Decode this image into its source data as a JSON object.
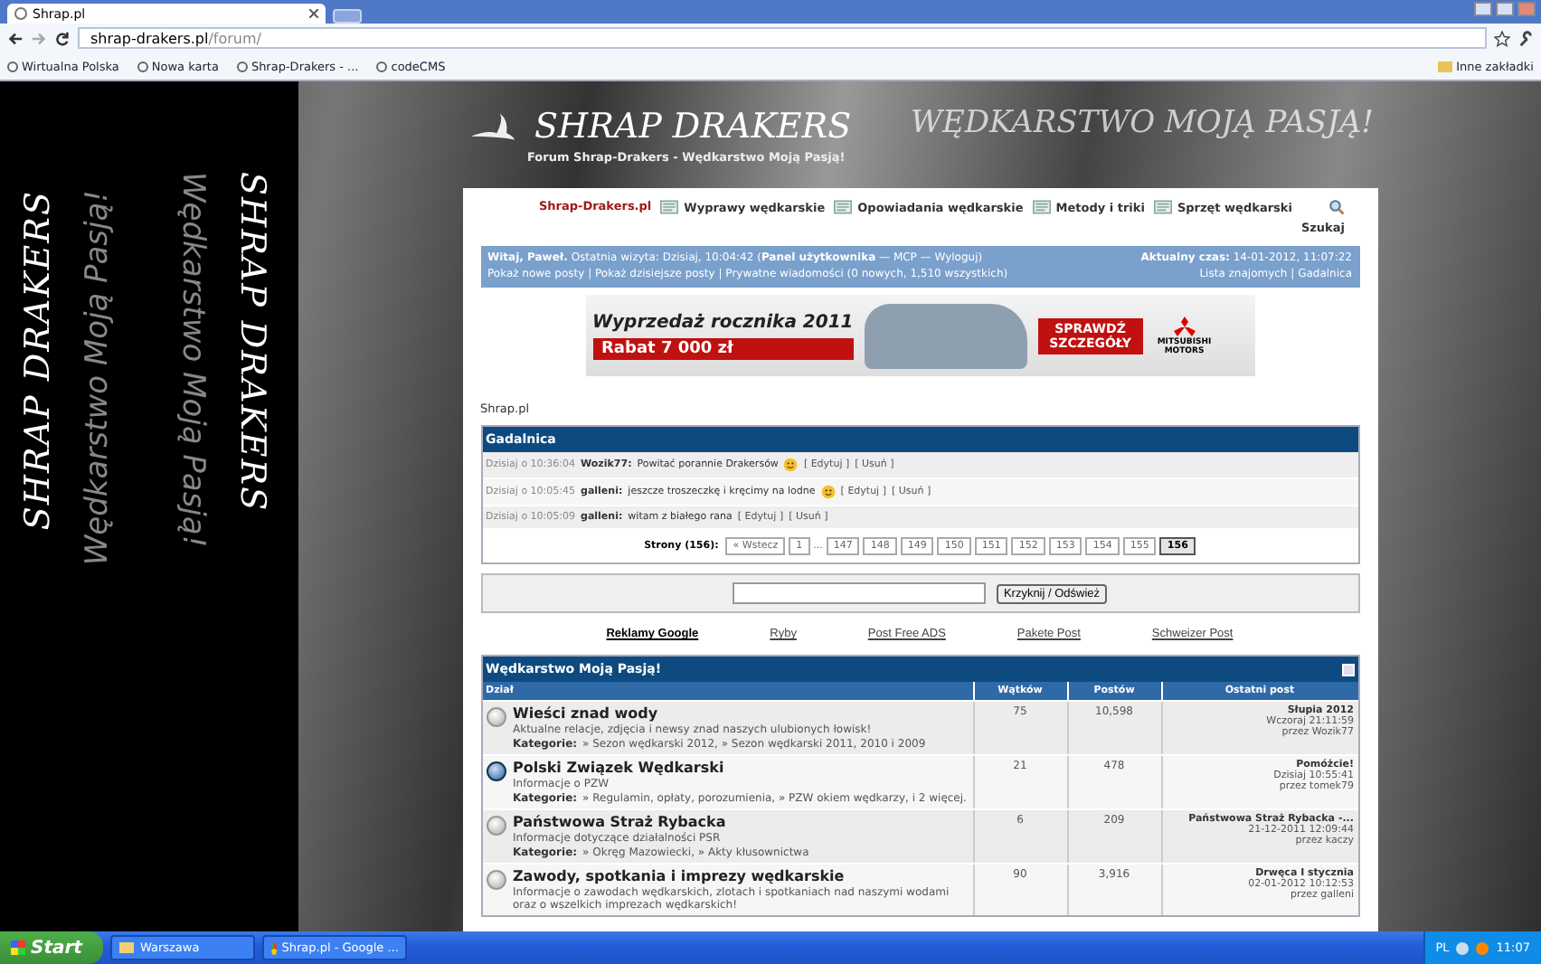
{
  "browser": {
    "tab_title": "Shrap.pl",
    "address_host": "shrap-drakers.pl",
    "address_path": "/forum/",
    "bookmarks": [
      "Wirtualna Polska",
      "Nowa karta",
      "Shrap-Drakers - ...",
      "codeCMS"
    ],
    "other_bookmarks": "Inne zakładki"
  },
  "side_banners": [
    {
      "title": "SHRAP DRAKERS",
      "slogan": "Wędkarstwo Moją Pasją!"
    },
    {
      "title": "SHRAP DRAKERS",
      "slogan": "Wędkarstwo Moją Pasją!"
    }
  ],
  "header": {
    "logo": "SHRAP DRAKERS",
    "subtitle": "Forum Shrap-Drakers - Wędkarstwo Moją Pasją!",
    "slogan": "WĘDKARSTWO MOJĄ PASJĄ!"
  },
  "nav": [
    {
      "kind": "home",
      "label": "Shrap-Drakers.pl"
    },
    {
      "kind": "link",
      "label": "Wyprawy wędkarskie"
    },
    {
      "kind": "link",
      "label": "Opowiadania wędkarskie"
    },
    {
      "kind": "link",
      "label": "Metody i triki"
    },
    {
      "kind": "link",
      "label": "Sprzęt wędkarski"
    },
    {
      "kind": "search",
      "label": "Szukaj"
    }
  ],
  "user_bar": {
    "welcome": "**Witaj, Paweł.** Ostatnia wizyta: Dzisiaj, 10:04:42 (**Panel użytkownika** — MCP — Wyloguj)",
    "links": "Pokaż nowe posty | Pokaż dzisiejsze posty | Prywatne wiadomości (0 nowych, 1,510 wszystkich)",
    "time": "**Aktualny czas:** 14-01-2012, 11:07:22",
    "right_links": "Lista znajomych | Gadalnica"
  },
  "ad": {
    "title": "Wyprzedaż rocznika 2011",
    "price": "Rabat 7 000 zł",
    "cta": "SPRAWDŹ SZCZEGÓŁY",
    "brand": "MITSUBISHI MOTORS"
  },
  "breadcrumb": "Shrap.pl",
  "shoutbox": {
    "title": "Gadalnica",
    "messages": [
      {
        "time": "Dzisiaj o 10:36:04",
        "author": "Wozik77:",
        "text": "Powitać porannie Drakersów",
        "smiley": true,
        "edit": "[ Edytuj ]",
        "delete": "[ Usuń ]"
      },
      {
        "time": "Dzisiaj o 10:05:45",
        "author": "galleni:",
        "text": "jeszcze troszeczkę i kręcimy na lodne",
        "smiley": true,
        "edit": "[ Edytuj ]",
        "delete": "[ Usuń ]"
      },
      {
        "time": "Dzisiaj o 10:05:09",
        "author": "galleni:",
        "text": "witam z białego rana",
        "smiley": false,
        "edit": "[ Edytuj ]",
        "delete": "[ Usuń ]"
      }
    ],
    "pages_label": "Strony (156):",
    "pages": [
      {
        "label": "« Wstecz",
        "selected": false
      },
      {
        "label": "1",
        "selected": false
      },
      {
        "label": "...",
        "kind": "gap"
      },
      {
        "label": "147",
        "selected": false
      },
      {
        "label": "148",
        "selected": false
      },
      {
        "label": "149",
        "selected": false
      },
      {
        "label": "150",
        "selected": false
      },
      {
        "label": "151",
        "selected": false
      },
      {
        "label": "152",
        "selected": false
      },
      {
        "label": "153",
        "selected": false
      },
      {
        "label": "154",
        "selected": false
      },
      {
        "label": "155",
        "selected": false
      },
      {
        "label": "156",
        "selected": true
      }
    ],
    "button": "Krzyknij / Odśwież"
  },
  "links": [
    {
      "label": "Reklamy Google",
      "bold": true
    },
    {
      "label": "Ryby",
      "bold": false
    },
    {
      "label": "Post Free ADS",
      "bold": false
    },
    {
      "label": "Pakete Post",
      "bold": false
    },
    {
      "label": "Schweizer Post",
      "bold": false
    }
  ],
  "forum": {
    "title": "Wędkarstwo Moją Pasją!",
    "columns": [
      "Dział",
      "Wątków",
      "Postów",
      "Ostatni post"
    ],
    "rows": [
      {
        "name": "Wieści znad wody",
        "unread": false,
        "description": "Aktualne relacje, zdjęcia i newsy znad naszych ulubionych łowisk!",
        "categories_label": "Kategorie:",
        "categories": "» Sezon wędkarski 2012,  » Sezon wędkarski 2011, 2010 i 2009",
        "threads": "75",
        "posts": "10,598",
        "last_title": "Słupia 2012",
        "last_time": "Wczoraj 21:11:59",
        "last_by": "przez Wozik77"
      },
      {
        "name": "Polski Związek Wędkarski",
        "unread": true,
        "description": "Informacje o PZW",
        "categories_label": "Kategorie:",
        "categories": "» Regulamin, opłaty, porozumienia,  » PZW okiem wędkarzy, i 2 więcej.",
        "threads": "21",
        "posts": "478",
        "last_title": "Pomóżcie!",
        "last_time": "Dzisiaj 10:55:41",
        "last_by": "przez tomek79"
      },
      {
        "name": "Państwowa Straż Rybacka",
        "unread": false,
        "description": "Informacje dotyczące działalności PSR",
        "categories_label": "Kategorie:",
        "categories": "» Okręg Mazowiecki,  » Akty kłusownictwa",
        "threads": "6",
        "posts": "209",
        "last_title": "Państwowa Straż Rybacka -...",
        "last_time": "21-12-2011 12:09:44",
        "last_by": "przez kaczy"
      },
      {
        "name": "Zawody, spotkania i imprezy wędkarskie",
        "unread": false,
        "description": "Informacje o zawodach wędkarskich, zlotach i spotkaniach nad naszymi wodami oraz o wszelkich imprezach wędkarskich!",
        "threads": "90",
        "posts": "3,916",
        "last_title": "Drwęca I stycznia",
        "last_time": "02-01-2012 10:12:53",
        "last_by": "przez galleni"
      }
    ]
  },
  "taskbar": {
    "start": "Start",
    "tasks": [
      {
        "label": "Warszawa",
        "kind": "folder"
      },
      {
        "label": "Shrap.pl - Google ...",
        "kind": "browser"
      }
    ],
    "language": "PL",
    "clock": "11:07"
  }
}
